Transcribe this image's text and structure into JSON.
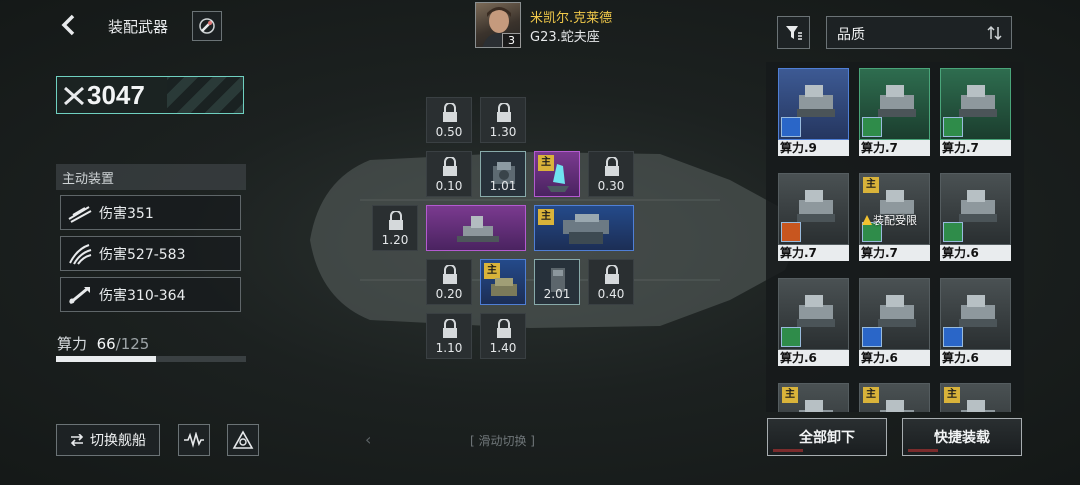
{
  "header": {
    "title": "装配武器",
    "pilot_name": "米凯尔.克莱德",
    "pilot_level": "3",
    "ship_name": "G23.蛇夫座"
  },
  "power": {
    "value": "3047"
  },
  "active_devices": {
    "title": "主动装置",
    "items": [
      {
        "label": "伤害351",
        "icon": "slash-damage-icon"
      },
      {
        "label": "伤害527-583",
        "icon": "claw-damage-icon"
      },
      {
        "label": "伤害310-364",
        "icon": "missile-damage-icon"
      }
    ]
  },
  "capacity": {
    "label": "算力",
    "used": "66",
    "total": "/125",
    "fill_fraction": 0.528
  },
  "bottom_left": {
    "switch_ship": "切换舰船"
  },
  "swipe_hint": "[ 滑动切换 ]",
  "slots": {
    "r1c1": "0.50",
    "r1c2": "1.30",
    "r2c1": "0.10",
    "r2c2": "1.01",
    "r2c4": "0.30",
    "r3c0": "1.20",
    "r4c1": "0.20",
    "r4c3": "2.01",
    "r4c4": "0.40",
    "r5c1": "1.10",
    "r5c2": "1.40"
  },
  "main_badge": "主",
  "right": {
    "quality_label": "品质",
    "unload_all": "全部卸下",
    "quick_equip": "快捷装载"
  },
  "inventory": [
    {
      "label": "算力.9",
      "rarity": "blue",
      "type": "blue",
      "main": false,
      "warning": ""
    },
    {
      "label": "算力.7",
      "rarity": "green",
      "type": "green",
      "main": false,
      "warning": ""
    },
    {
      "label": "算力.7",
      "rarity": "green",
      "type": "green",
      "main": false,
      "warning": ""
    },
    {
      "label": "算力.7",
      "rarity": "grey",
      "type": "orange",
      "main": false,
      "warning": ""
    },
    {
      "label": "算力.7",
      "rarity": "grey",
      "type": "green",
      "main": true,
      "warning": "装配受限"
    },
    {
      "label": "算力.6",
      "rarity": "grey",
      "type": "green",
      "main": false,
      "warning": ""
    },
    {
      "label": "算力.6",
      "rarity": "grey",
      "type": "green",
      "main": false,
      "warning": ""
    },
    {
      "label": "算力.6",
      "rarity": "grey",
      "type": "blue",
      "main": false,
      "warning": ""
    },
    {
      "label": "算力.6",
      "rarity": "grey",
      "type": "blue",
      "main": false,
      "warning": ""
    },
    {
      "label": "",
      "rarity": "grey",
      "type": "",
      "main": true,
      "warning": ""
    },
    {
      "label": "",
      "rarity": "grey",
      "type": "",
      "main": true,
      "warning": ""
    },
    {
      "label": "",
      "rarity": "grey",
      "type": "",
      "main": true,
      "warning": ""
    }
  ],
  "colors": {
    "accent_teal": "#6fd0c0",
    "pilot_name": "#f1c94a",
    "rarity_blue": "#4f7fd6",
    "rarity_green": "#4aa57a",
    "rarity_purple": "#b45ad0",
    "main_badge": "#d9b33a"
  }
}
